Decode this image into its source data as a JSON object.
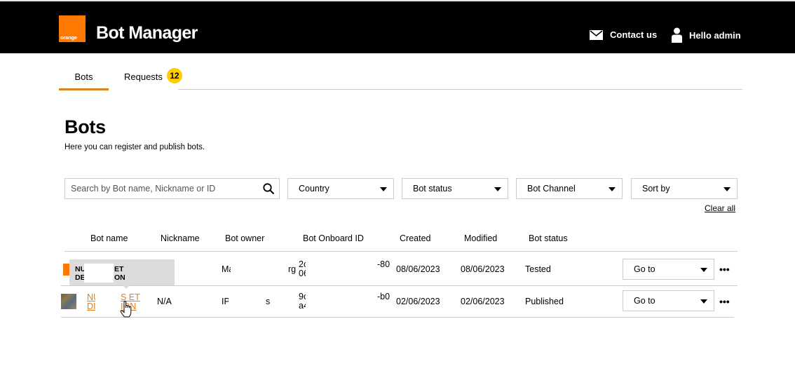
{
  "header": {
    "logo_text": "orange",
    "app_title": "Bot Manager",
    "contact_label": "Contact us",
    "user_greeting": "Hello admin",
    "brand_color": "#ff7900"
  },
  "tabs": [
    {
      "label": "Bots",
      "active": true
    },
    {
      "label": "Requests",
      "badge": "12"
    }
  ],
  "page": {
    "title": "Bots",
    "subtitle": "Here you can register and publish bots."
  },
  "filters": {
    "search_placeholder": "Search by Bot name, Nickname or ID",
    "country": "Country",
    "bot_status": "Bot status",
    "bot_channel": "Bot Channel",
    "sort_by": "Sort by",
    "clear_all": "Clear all"
  },
  "table": {
    "columns": [
      "Bot name",
      "Nickname",
      "Bot owner",
      "Bot Onboard ID",
      "Created",
      "Modified",
      "Bot status"
    ],
    "rows": [
      {
        "icon": "orange-logo-icon",
        "name_line1": "NU",
        "name_line2": "DE",
        "nickname": "",
        "owner_start": "Ma",
        "owner_end": "rg",
        "id_line1_start": "2c",
        "id_line2_start": "06",
        "id_end": "-80",
        "created": "08/06/2023",
        "modified": "08/06/2023",
        "status": "Tested",
        "action": "Go to",
        "more": "•••"
      },
      {
        "icon": "nuances-logo-icon",
        "name_line1": "NU",
        "name_line2": "DI",
        "name_part2_line1": "S ET",
        "name_part2_line2": "ION",
        "nickname": "N/A",
        "owner_start": "IP",
        "owner_end": "s",
        "id_line1_start": "9c",
        "id_line2_start": "a4",
        "id_end": "-b0",
        "created": "02/06/2023",
        "modified": "02/06/2023",
        "status": "Published",
        "action": "Go to",
        "more": "•••"
      }
    ]
  },
  "tooltip": {
    "line1_start": "NU",
    "line1_end": "ET",
    "line2_start": "DE",
    "line2_end": "ON"
  }
}
